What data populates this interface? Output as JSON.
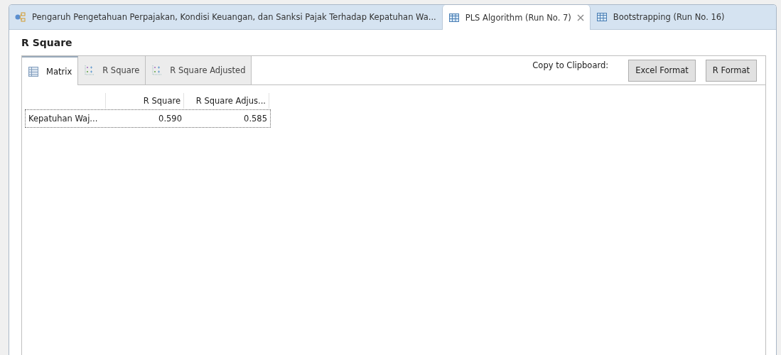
{
  "editor_tabs": [
    {
      "label": "Pengaruh Pengetahuan Perpajakan, Kondisi Keuangan, dan Sanksi Pajak Terhadap Kepatuhan Wa...",
      "kind": "model",
      "selected": false,
      "closable": false
    },
    {
      "label": "PLS Algorithm (Run No. 7)",
      "kind": "report",
      "selected": true,
      "closable": true
    },
    {
      "label": "Bootstrapping (Run No. 16)",
      "kind": "report",
      "selected": false,
      "closable": false
    }
  ],
  "title": "R Square",
  "view_tabs": [
    {
      "label": "Matrix",
      "kind": "matrix",
      "selected": true
    },
    {
      "label": "R Square",
      "kind": "chart",
      "selected": false
    },
    {
      "label": "R Square Adjusted",
      "kind": "chart",
      "selected": false
    }
  ],
  "copy_label": "Copy to Clipboard:",
  "buttons": [
    "Excel Format",
    "R Format"
  ],
  "table": {
    "columns": [
      "R Square",
      "R Square Adjus..."
    ],
    "rows": [
      {
        "label": "Kepatuhan Waj...",
        "cells": [
          "0.590",
          "0.585"
        ],
        "selected": true
      }
    ]
  }
}
